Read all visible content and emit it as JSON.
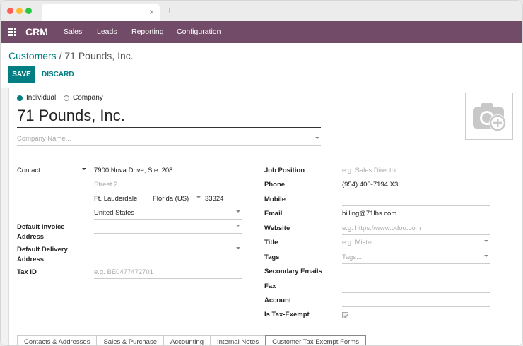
{
  "browser": {
    "close_glyph": "×",
    "newtab_glyph": "+"
  },
  "nav": {
    "brand": "CRM",
    "items": [
      "Sales",
      "Leads",
      "Reporting",
      "Configuration"
    ],
    "color": "#714b67"
  },
  "breadcrumb": {
    "parent": "Customers",
    "separator": " / ",
    "current": "71 Pounds, Inc."
  },
  "actions": {
    "save": "SAVE",
    "discard": "DISCARD"
  },
  "type_options": {
    "individual": "Individual",
    "company": "Company",
    "selected": "Individual"
  },
  "partner": {
    "name": "71 Pounds, Inc.",
    "company_placeholder": "Company Name..."
  },
  "address": {
    "type": "Contact",
    "street": "7900 Nova Drive, Ste. 208",
    "street2_placeholder": "Street 2...",
    "city": "Ft. Lauderdale",
    "state": "Florida (US)",
    "zip": "33324",
    "country": "United States"
  },
  "left_fields": {
    "default_invoice_address_label_1": "Default Invoice",
    "default_invoice_address_label_2": "Address",
    "default_delivery_address_label_1": "Default Delivery",
    "default_delivery_address_label_2": "Address",
    "tax_id_label": "Tax ID",
    "tax_id_placeholder": "e.g. BE0477472701"
  },
  "right_fields": {
    "job_position_label": "Job Position",
    "job_position_placeholder": "e.g. Sales Director",
    "phone_label": "Phone",
    "phone": "(954) 400-7194 X3",
    "mobile_label": "Mobile",
    "email_label": "Email",
    "email": "billing@71lbs.com",
    "website_label": "Website",
    "website_placeholder": "e.g. https://www.odoo.com",
    "title_label": "Title",
    "title_placeholder": "e.g. Mister",
    "tags_label": "Tags",
    "tags_placeholder": "Tags...",
    "secondary_emails_label": "Secondary Emails",
    "fax_label": "Fax",
    "account_label": "Account",
    "tax_exempt_label": "Is Tax-Exempt",
    "tax_exempt_checked": true
  },
  "notebook_tabs": [
    "Contacts & Addresses",
    "Sales & Purchase",
    "Accounting",
    "Internal Notes",
    "Customer Tax Exempt Forms"
  ],
  "colors": {
    "accent": "#017e84"
  },
  "icons": {
    "avatar": "camera-plus-icon",
    "apps": "apps-grid-icon"
  }
}
